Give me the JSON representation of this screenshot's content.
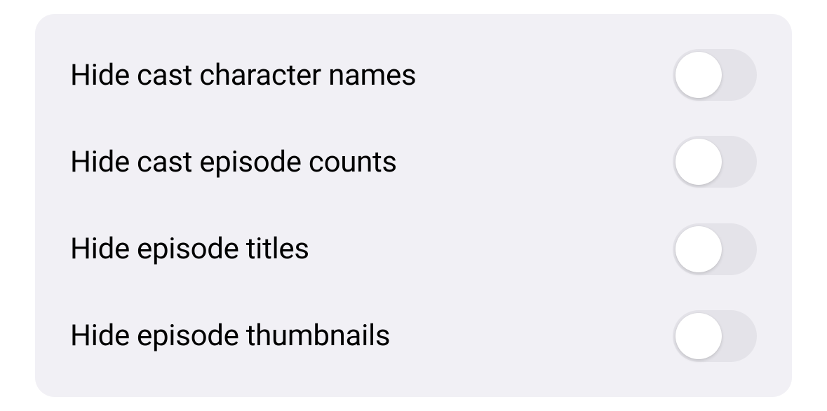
{
  "settings": {
    "items": [
      {
        "id": "hide-cast-character-names",
        "label": "Hide cast character names",
        "enabled": false
      },
      {
        "id": "hide-cast-episode-counts",
        "label": "Hide cast episode counts",
        "enabled": false
      },
      {
        "id": "hide-episode-titles",
        "label": "Hide episode titles",
        "enabled": false
      },
      {
        "id": "hide-episode-thumbnails",
        "label": "Hide episode thumbnails",
        "enabled": false
      }
    ]
  }
}
